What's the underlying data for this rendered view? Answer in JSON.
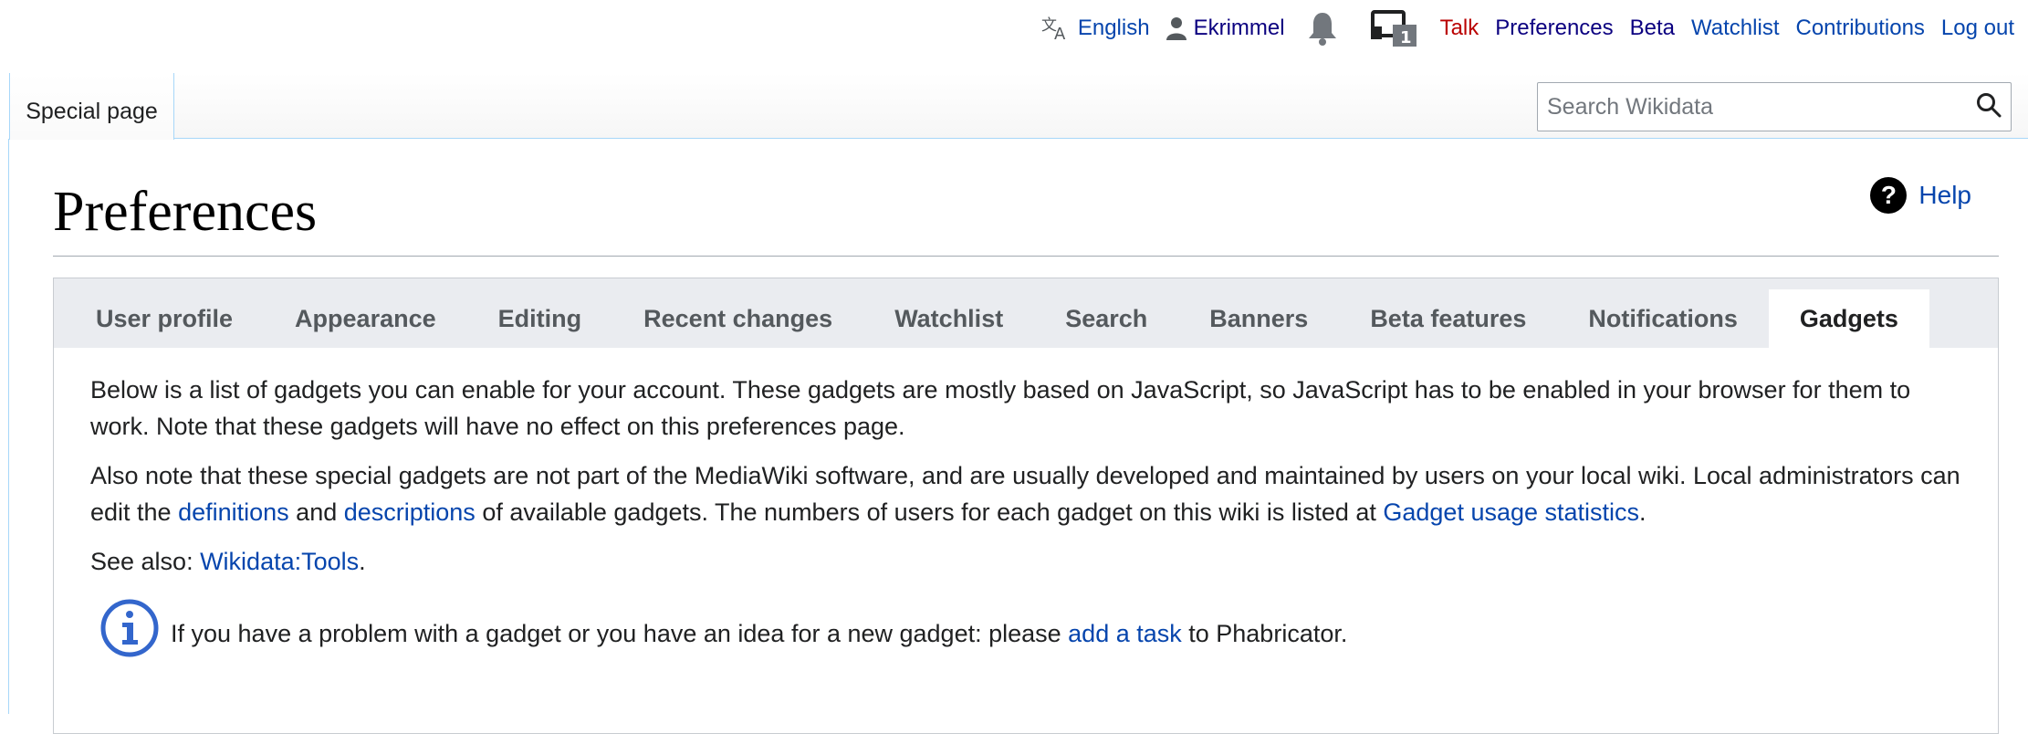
{
  "personal_tools": {
    "language": "English",
    "username": "Ekrimmel",
    "sandbox_badge": "1",
    "talk": "Talk",
    "preferences": "Preferences",
    "beta": "Beta",
    "watchlist": "Watchlist",
    "contributions": "Contributions",
    "logout": "Log out"
  },
  "header": {
    "page_tab": "Special page",
    "search_placeholder": "Search Wikidata"
  },
  "page": {
    "title": "Preferences",
    "help": "Help"
  },
  "tabs": [
    {
      "label": "User profile",
      "active": false
    },
    {
      "label": "Appearance",
      "active": false
    },
    {
      "label": "Editing",
      "active": false
    },
    {
      "label": "Recent changes",
      "active": false
    },
    {
      "label": "Watchlist",
      "active": false
    },
    {
      "label": "Search",
      "active": false
    },
    {
      "label": "Banners",
      "active": false
    },
    {
      "label": "Beta features",
      "active": false
    },
    {
      "label": "Notifications",
      "active": false
    },
    {
      "label": "Gadgets",
      "active": true
    }
  ],
  "gadgets": {
    "intro": "Below is a list of gadgets you can enable for your account. These gadgets are mostly based on JavaScript, so JavaScript has to be enabled in your browser for them to work. Note that these gadgets will have no effect on this preferences page.",
    "note_part1": "Also note that these special gadgets are not part of the MediaWiki software, and are usually developed and maintained by users on your local wiki. Local administrators can edit the ",
    "definitions_link": "definitions",
    "note_and": " and ",
    "descriptions_link": "descriptions",
    "note_part2": " of available gadgets. The numbers of users for each gadget on this wiki is listed at ",
    "usage_link": "Gadget usage statistics",
    "note_end": ".",
    "see_also_label": "See also: ",
    "tools_link": "Wikidata:Tools",
    "see_also_end": ".",
    "notice_part1": "If you have a problem with a gadget or you have an idea for a new gadget: please ",
    "add_task_link": "add a task",
    "notice_part2": " to Phabricator."
  },
  "icons": {
    "language": "translate-icon",
    "user": "user-icon",
    "bell": "bell-icon",
    "sandbox": "devices-icon",
    "search": "magnifier-icon",
    "help": "question-circle-icon",
    "info": "info-circle-icon"
  },
  "colors": {
    "link": "#0645ad",
    "visited": "#0b0080",
    "redlink": "#ba0000",
    "tab_bg": "#eaecf0",
    "info_blue": "#3366cc"
  }
}
